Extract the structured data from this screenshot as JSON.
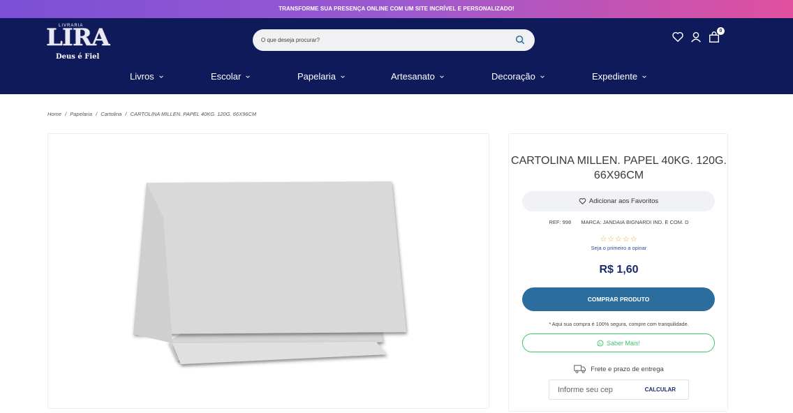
{
  "promo": {
    "text": "TRANSFORME SUA PRESENÇA ONLINE COM UM SITE INCRÍVEL E PERSONALIZADO!"
  },
  "logo": {
    "small": "LIVRARIA",
    "name": "LIRA",
    "tagline": "Deus é Fiel"
  },
  "search": {
    "placeholder": "O que deseja procurar?",
    "icon": "search-icon"
  },
  "header_icons": {
    "wishlist": "heart-icon",
    "account": "user-icon",
    "cart": "bag-icon",
    "cart_count": "0"
  },
  "nav": {
    "items": [
      {
        "label": "Livros"
      },
      {
        "label": "Escolar"
      },
      {
        "label": "Papelaria"
      },
      {
        "label": "Artesanato"
      },
      {
        "label": "Decoração"
      },
      {
        "label": "Expediente"
      }
    ]
  },
  "breadcrumb": {
    "items": [
      "Home",
      "/",
      "Papelaria",
      "/",
      "Cartolina",
      "/",
      "CARTOLINA MILLEN. PAPEL 40KG. 120G. 66X96CM"
    ]
  },
  "product": {
    "title": "CARTOLINA MILLEN. PAPEL 40KG. 120G. 66X96CM",
    "favorite_label": "Adicionar aos Favoritos",
    "ref_label": "REF:",
    "ref_value": "998",
    "brand_label": "MARCA:",
    "brand_value": "JANDAIA BIGNARDI IND. E COM. D",
    "stars": "☆☆☆☆☆",
    "rating_link": "Seja o primeiro a opinar",
    "price": "R$ 1,60",
    "buy_label": "COMPRAR PRODUTO",
    "secure_text": "* Aqui sua compra é 100% segura, compre com tranquilidade.",
    "whatsapp_label": "Saber Mais!",
    "shipping_label": "Frete e prazo de entrega",
    "cep_placeholder": "Informe seu cep",
    "calc_label": "CALCULAR"
  },
  "colors": {
    "header_bg": "#0f1a5a",
    "buy_btn": "#2b6e9e",
    "whatsapp": "#3ec46d",
    "price": "#1a2a6c"
  }
}
